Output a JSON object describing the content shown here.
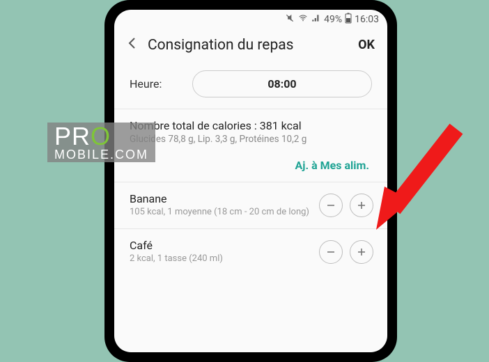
{
  "statusbar": {
    "battery": "49%",
    "time": "16:03"
  },
  "appbar": {
    "title": "Consignation du repas",
    "ok_label": "OK"
  },
  "time_row": {
    "label": "Heure:",
    "value": "08:00"
  },
  "totals": {
    "line1": "Nombre total de calories : 381 kcal",
    "line2": "Glucides 78,8 g, Lip. 3,3 g, Protéines 10,2 g"
  },
  "add_link_label": "Aj. à Mes alim.",
  "foods": [
    {
      "name": "Banane",
      "detail": "105 kcal, 1 moyenne (18 cm - 20 cm de long)"
    },
    {
      "name": "Café",
      "detail": "2 kcal, 1 tasse (240 ml)"
    }
  ],
  "watermark": {
    "line1a": "PR",
    "line1b": "O",
    "line2": "MOBILE.COM"
  }
}
